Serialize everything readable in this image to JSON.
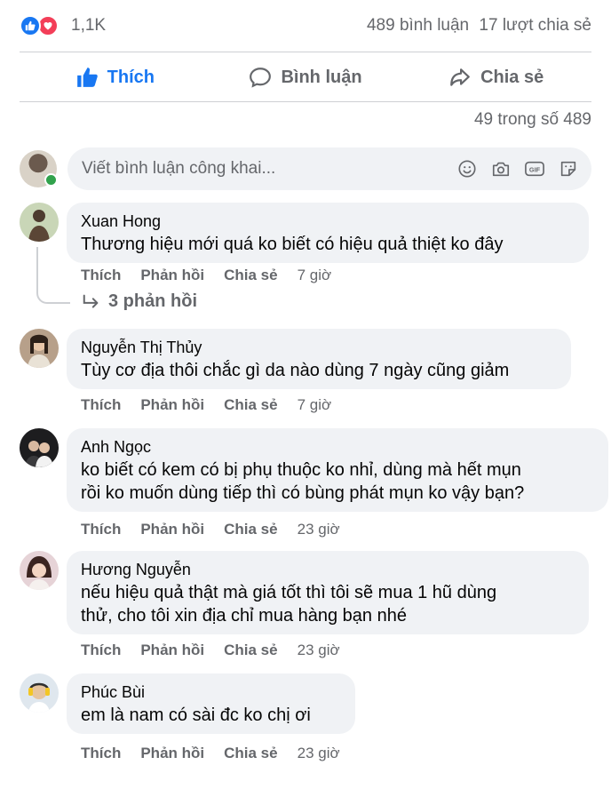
{
  "stats": {
    "reaction_count": "1,1K",
    "comments": "489 bình luận",
    "shares": "17 lượt chia sẻ",
    "icons": [
      "like-icon",
      "love-icon"
    ],
    "like_color": "#1877f2",
    "love_color": "#f33e58"
  },
  "actions": {
    "like": "Thích",
    "comment": "Bình luận",
    "share": "Chia sẻ"
  },
  "count_line": "49 trong số 489",
  "composer": {
    "placeholder": "Viết bình luận công khai...",
    "tools": [
      "emoji-icon",
      "camera-icon",
      "gif-icon",
      "sticker-icon"
    ]
  },
  "comments": [
    {
      "author": "Xuan Hong",
      "lines": [
        "Thương hiệu mới quá ko biết có hiệu quả thiệt ko đây"
      ],
      "actions": [
        "Thích",
        "Phản hồi",
        "Chia sẻ"
      ],
      "time": "7 giờ",
      "replies": "3 phản hồi"
    },
    {
      "author": "Nguyễn Thị Thủy",
      "lines": [
        "Tùy cơ địa thôi chắc gì da nào dùng 7 ngày cũng giảm"
      ],
      "actions": [
        "Thích",
        "Phản hồi",
        "Chia sẻ"
      ],
      "time": "7 giờ"
    },
    {
      "author": "Anh Ngọc",
      "lines": [
        "ko biết có kem có bị phụ thuộc ko nhỉ, dùng mà hết mụn",
        "rồi ko muốn dùng tiếp thì có bùng phát mụn ko vậy bạn?"
      ],
      "actions": [
        "Thích",
        "Phản hồi",
        "Chia sẻ"
      ],
      "time": "23 giờ"
    },
    {
      "author": "Hương Nguyễn",
      "lines": [
        "nếu hiệu quả thật mà giá tốt thì tôi sẽ mua 1 hũ dùng",
        "thử, cho tôi xin địa chỉ mua hàng bạn nhé"
      ],
      "actions": [
        "Thích",
        "Phản hồi",
        "Chia sẻ"
      ],
      "time": "23 giờ"
    },
    {
      "author": "Phúc Bùi",
      "lines": [
        "em là nam có sài đc ko chị ơi"
      ],
      "actions": [
        "Thích",
        "Phản hồi",
        "Chia sẻ"
      ],
      "time": "23 giờ"
    }
  ]
}
